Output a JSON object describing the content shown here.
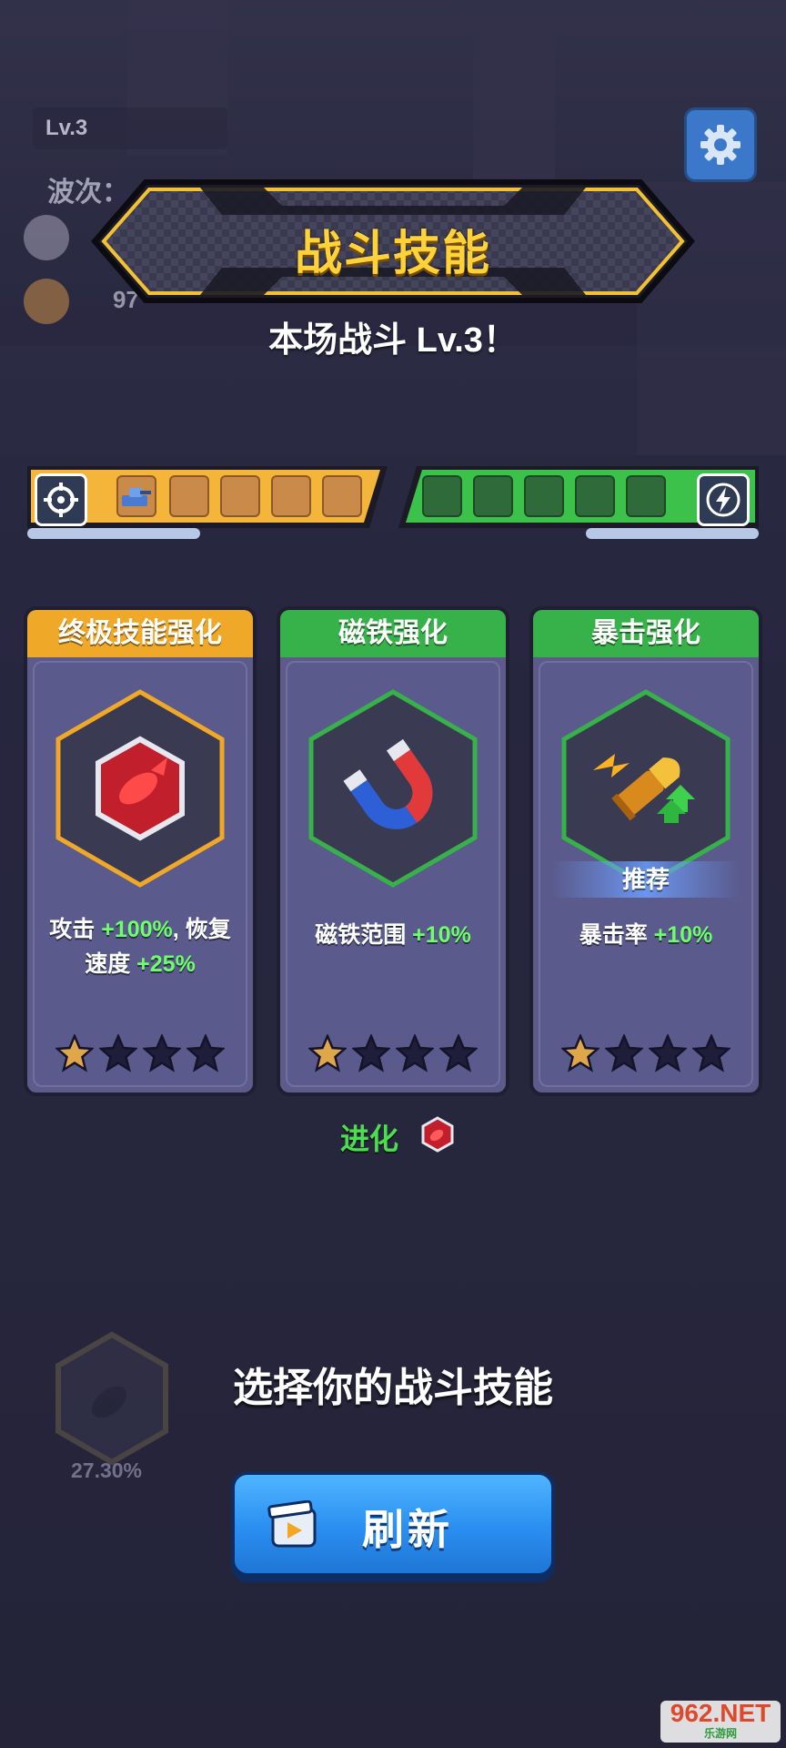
{
  "hud": {
    "level": "Lv.3",
    "wave_label": "波次：",
    "coin_value": "97"
  },
  "banner": {
    "title": "战斗技能",
    "subtitle": "本场战斗 Lv.3！"
  },
  "slots": {
    "attack_slot_count": 5,
    "attack_filled": 1,
    "passive_slot_count": 5,
    "passive_filled": 0
  },
  "cards": [
    {
      "title": "终极技能强化",
      "header_color": "#f0a829",
      "frame_color": "#f0a829",
      "icon": "bomb-icon",
      "desc_parts": [
        "攻击 ",
        "+100%",
        ", 恢复",
        "速度 ",
        "+25%"
      ],
      "stars_filled": 1,
      "stars_total": 4,
      "recommended": false
    },
    {
      "title": "磁铁强化",
      "header_color": "#37b24a",
      "frame_color": "#37b24a",
      "icon": "magnet-icon",
      "desc_parts": [
        "磁铁范围 ",
        "+10%"
      ],
      "stars_filled": 1,
      "stars_total": 4,
      "recommended": false
    },
    {
      "title": "暴击强化",
      "header_color": "#37b24a",
      "frame_color": "#37b24a",
      "icon": "bullet-icon",
      "desc_parts": [
        "暴击率 ",
        "+10%"
      ],
      "stars_filled": 1,
      "stars_total": 4,
      "recommended": true,
      "recommend_label": "推荐"
    }
  ],
  "evolve_label": "进化",
  "prompt": "选择你的战斗技能",
  "progress_percent": "27.30%",
  "refresh_label": "刷新",
  "watermark": {
    "top": "962.NET",
    "bottom": "乐游网"
  }
}
